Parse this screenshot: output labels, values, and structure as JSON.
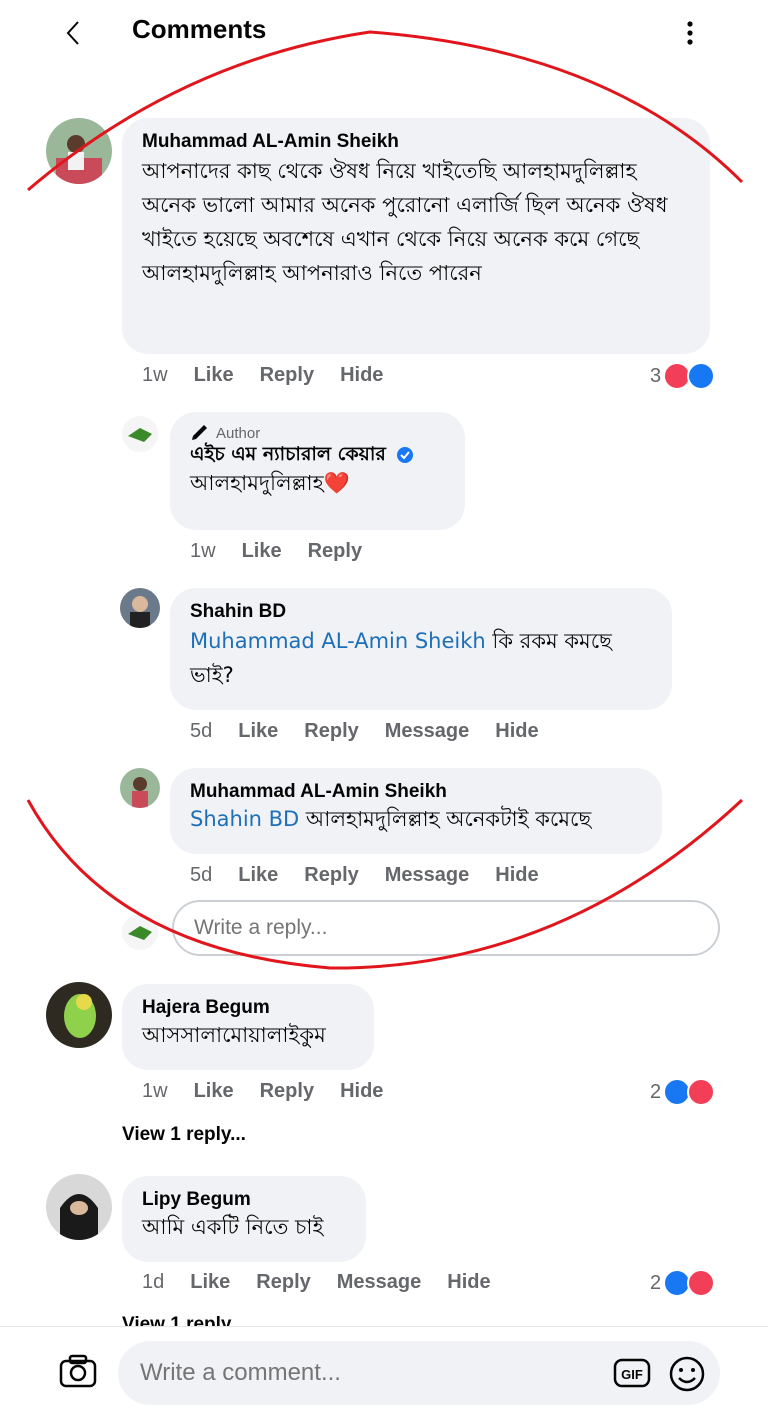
{
  "header": {
    "title": "Comments"
  },
  "comments": [
    {
      "name": "Muhammad AL-Amin Sheikh",
      "text": "আপনাদের কাছ থেকে ঔষধ নিয়ে খাইতেছি আলহামদুলিল্লাহ অনেক ভালো আমার অনেক পুরোনো এলার্জি ছিল অনেক ঔষধ খাইতে হয়েছে অবশেষে এখান থেকে নিয়ে অনেক কমে গেছে আলহামদুলিল্লাহ আপনারাও নিতে পারেন",
      "time": "1w",
      "like": "Like",
      "reply": "Reply",
      "hide": "Hide",
      "react_count": "3"
    },
    {
      "author_label": "Author",
      "name": "এইচ এম ন্যাচারাল কেয়ার",
      "text": "আলহামদুলিল্লাহ",
      "emoji": "❤️",
      "time": "1w",
      "like": "Like",
      "reply": "Reply"
    },
    {
      "name": "Shahin BD",
      "mention": "Muhammad AL-Amin Sheikh",
      "text": " কি রকম কমছে ভাই?",
      "time": "5d",
      "like": "Like",
      "reply": "Reply",
      "message": "Message",
      "hide": "Hide"
    },
    {
      "name": "Muhammad AL-Amin Sheikh",
      "mention": "Shahin BD",
      "text": " আলহামদুলিল্লাহ অনেকটাই কমেছে",
      "time": "5d",
      "like": "Like",
      "reply": "Reply",
      "message": "Message",
      "hide": "Hide"
    },
    {
      "name": "Hajera Begum",
      "text": "আসসালামোয়ালাইকুম",
      "time": "1w",
      "like": "Like",
      "reply": "Reply",
      "hide": "Hide",
      "react_count": "2",
      "view_replies": "View 1 reply..."
    },
    {
      "name": "Lipy Begum",
      "text": "আমি একটি নিতে চাই",
      "time": "1d",
      "like": "Like",
      "reply": "Reply",
      "message": "Message",
      "hide": "Hide",
      "react_count": "2",
      "view_replies": "View 1 reply"
    }
  ],
  "reply_input": {
    "placeholder": "Write a reply..."
  },
  "comment_input": {
    "placeholder": "Write a comment..."
  },
  "colors": {
    "heart": "#f33e58",
    "like": "#1877f2",
    "annotation": "#e0161c",
    "mention": "#1d6fb8"
  }
}
